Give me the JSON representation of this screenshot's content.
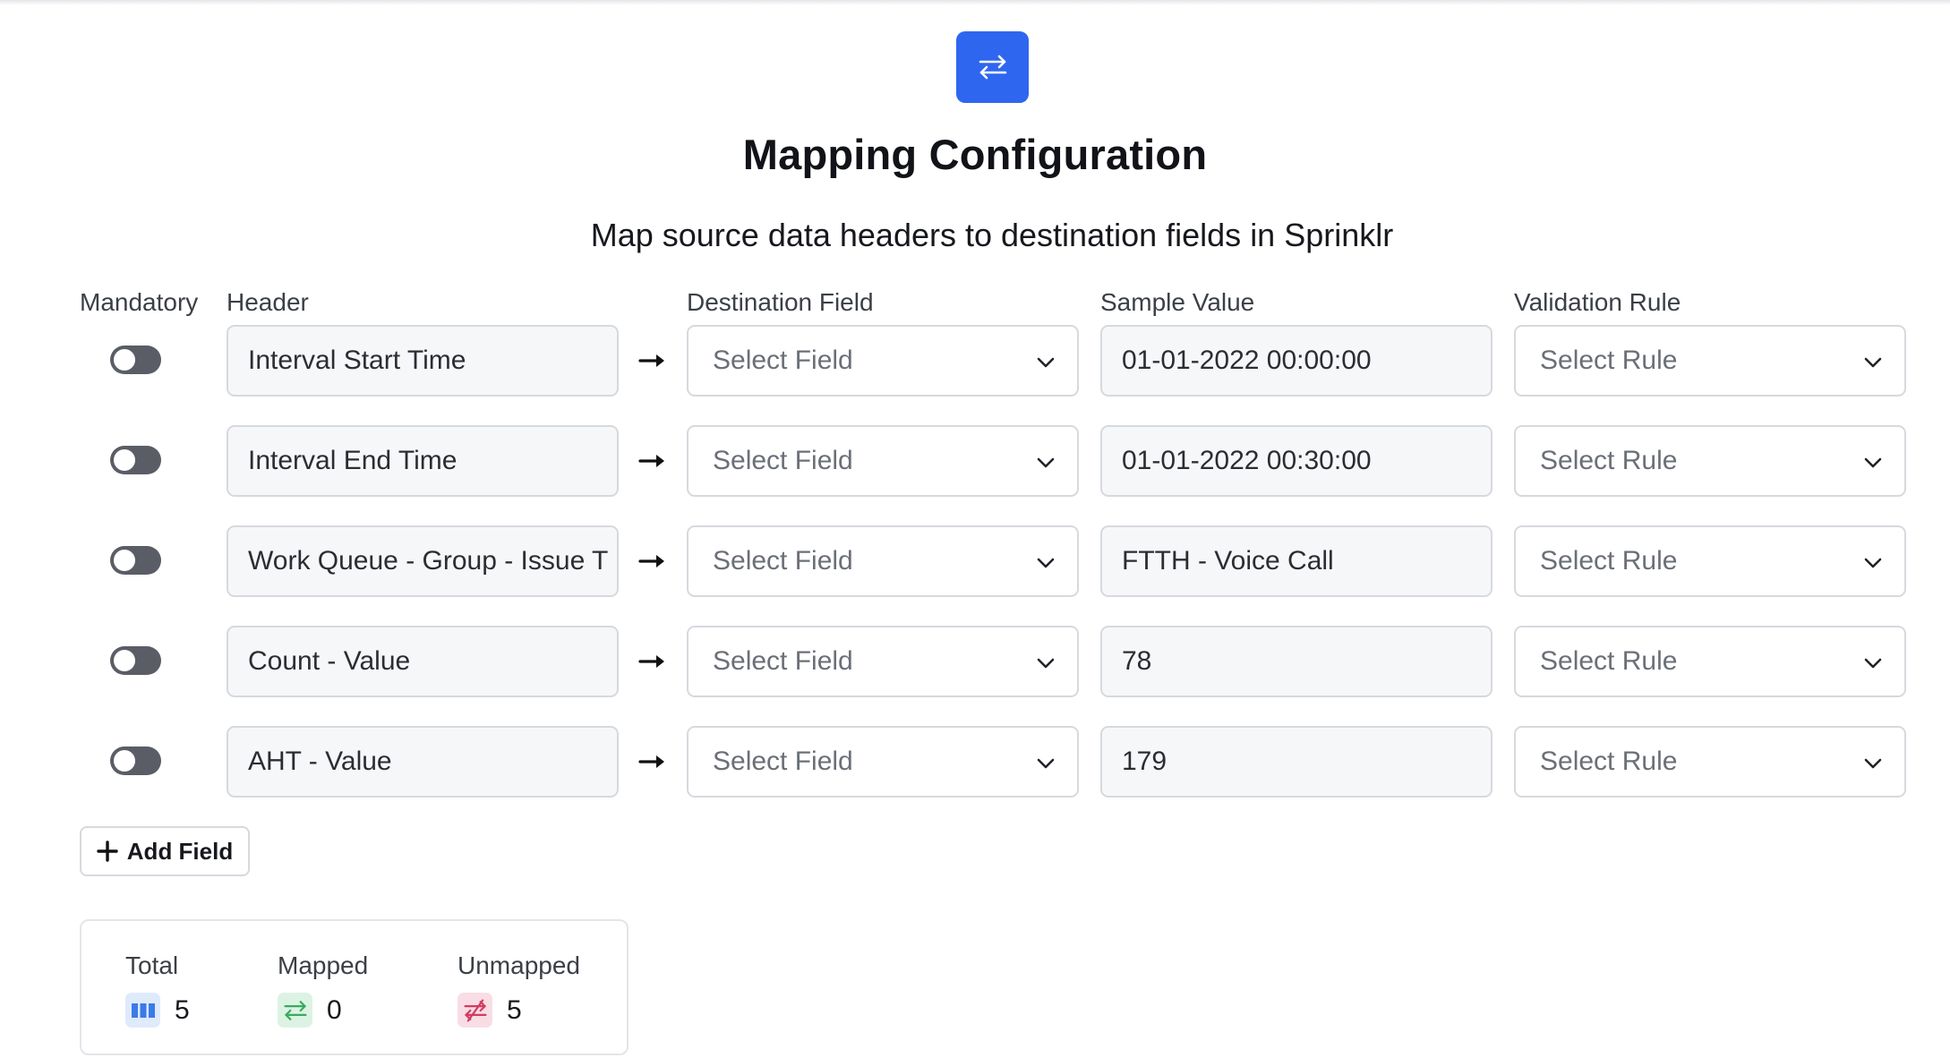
{
  "header": {
    "title": "Mapping Configuration",
    "subtitle": "Map source data headers to destination fields in Sprinklr",
    "icon": "swap-arrows-icon"
  },
  "columns": {
    "mandatory": "Mandatory",
    "header": "Header",
    "destination": "Destination Field",
    "sample": "Sample Value",
    "validation": "Validation Rule"
  },
  "rows": [
    {
      "mandatory": false,
      "header": "Interval Start Time",
      "destination": "Select Field",
      "sample": "01-01-2022 00:00:00",
      "rule": "Select Rule"
    },
    {
      "mandatory": false,
      "header": "Interval End Time",
      "destination": "Select Field",
      "sample": "01-01-2022 00:30:00",
      "rule": "Select Rule"
    },
    {
      "mandatory": false,
      "header": "Work Queue - Group - Issue T",
      "destination": "Select Field",
      "sample": "FTTH - Voice Call",
      "rule": "Select Rule"
    },
    {
      "mandatory": false,
      "header": "Count - Value",
      "destination": "Select Field",
      "sample": "78",
      "rule": "Select Rule"
    },
    {
      "mandatory": false,
      "header": "AHT - Value",
      "destination": "Select Field",
      "sample": "179",
      "rule": "Select Rule"
    }
  ],
  "actions": {
    "add_field": "Add Field"
  },
  "stats": {
    "total_label": "Total",
    "total_value": "5",
    "mapped_label": "Mapped",
    "mapped_value": "0",
    "unmapped_label": "Unmapped",
    "unmapped_value": "5"
  },
  "colors": {
    "accent": "#2f66f0",
    "total_icon_bg": "#dfeafb",
    "mapped_icon_bg": "#dcf3e3",
    "unmapped_icon_bg": "#f9dde4"
  }
}
